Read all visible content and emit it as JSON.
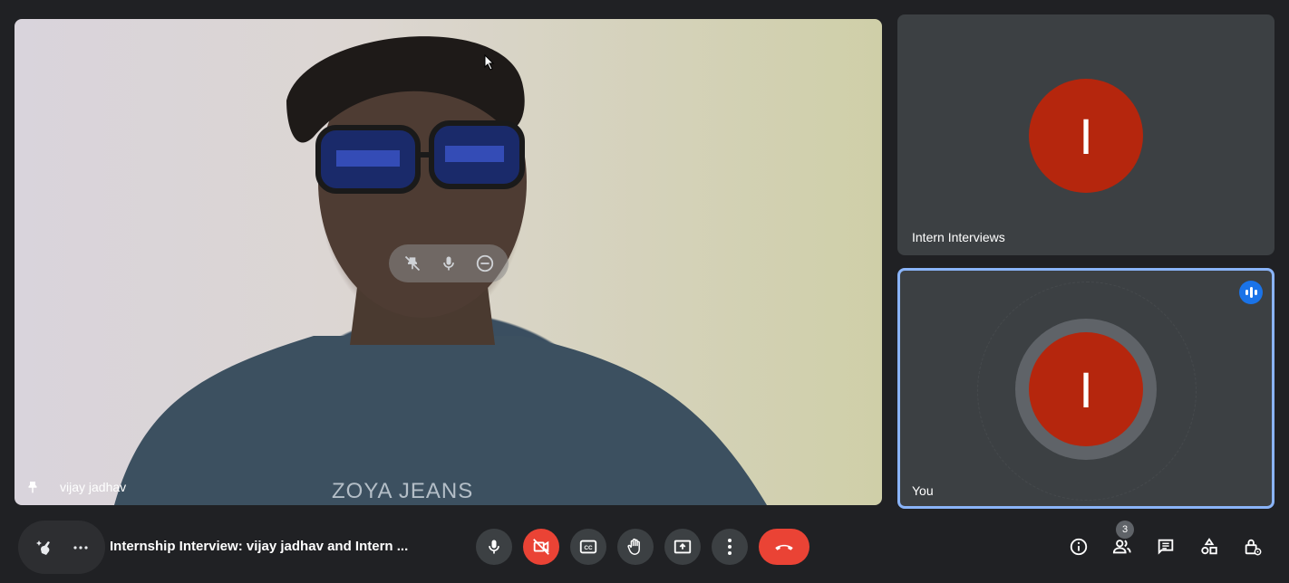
{
  "main_tile": {
    "participant_name": "vijay jadhav",
    "shirt_text": "ZOYA JEANS"
  },
  "side_tiles": [
    {
      "name": "Intern Interviews",
      "avatar_letter": "I",
      "avatar_color": "#b5260d"
    },
    {
      "name": "You",
      "avatar_letter": "I",
      "avatar_color": "#b5260d",
      "speaking": true
    }
  ],
  "bottom_bar": {
    "meeting_title": "Internship Interview: vijay jadhav and Intern ...",
    "people_count": "3",
    "controls": [
      "mic-icon",
      "camera-off-icon",
      "captions-icon",
      "raise-hand-icon",
      "present-icon",
      "more-options-icon",
      "end-call-icon"
    ],
    "right_icons": [
      "info-icon",
      "people-icon",
      "chat-icon",
      "activities-icon",
      "host-controls-icon"
    ]
  },
  "colors": {
    "accent": "#8ab4f8",
    "danger": "#ea4335",
    "bg": "#202124",
    "tile": "#3c4043"
  }
}
